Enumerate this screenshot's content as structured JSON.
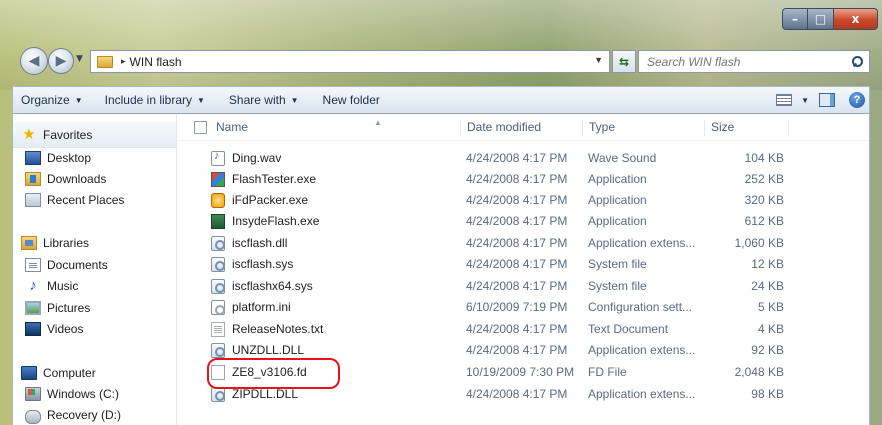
{
  "window": {
    "minimize_label": "–",
    "maximize_label": "□",
    "close_label": "x"
  },
  "address_bar": {
    "back_label": "◀",
    "forward_label": "▶",
    "separator": "▸",
    "path": "WIN flash",
    "dropdown_label": "▼",
    "refresh_label": "⇆",
    "search_placeholder": "Search WIN flash"
  },
  "toolbar": {
    "organize": "Organize",
    "include_in_library": "Include in library",
    "share_with": "Share with",
    "new_folder": "New folder",
    "arrow": "▼",
    "help": "?"
  },
  "nav_pane": {
    "favorites": "Favorites",
    "desktop": "Desktop",
    "downloads": "Downloads",
    "recent_places": "Recent Places",
    "libraries": "Libraries",
    "documents": "Documents",
    "music": "Music",
    "pictures": "Pictures",
    "videos": "Videos",
    "computer": "Computer",
    "windows_c": "Windows (C:)",
    "recovery_d": "Recovery (D:)",
    "star_glyph": "★",
    "music_glyph": "♪"
  },
  "columns": {
    "name": "Name",
    "date_modified": "Date modified",
    "type": "Type",
    "size": "Size",
    "sort_glyph": "▲"
  },
  "files": [
    {
      "name": "Ding.wav",
      "date": "4/24/2008 4:17 PM",
      "type": "Wave Sound",
      "size": "104 KB",
      "icon": "audio-file-icon"
    },
    {
      "name": "FlashTester.exe",
      "date": "4/24/2008 4:17 PM",
      "type": "Application",
      "size": "252 KB",
      "icon": "application-icon"
    },
    {
      "name": "iFdPacker.exe",
      "date": "4/24/2008 4:17 PM",
      "type": "Application",
      "size": "320 KB",
      "icon": "application-icon"
    },
    {
      "name": "InsydeFlash.exe",
      "date": "4/24/2008 4:17 PM",
      "type": "Application",
      "size": "612 KB",
      "icon": "application-icon"
    },
    {
      "name": "iscflash.dll",
      "date": "4/24/2008 4:17 PM",
      "type": "Application extens...",
      "size": "1,060 KB",
      "icon": "dll-file-icon"
    },
    {
      "name": "iscflash.sys",
      "date": "4/24/2008 4:17 PM",
      "type": "System file",
      "size": "12 KB",
      "icon": "system-file-icon"
    },
    {
      "name": "iscflashx64.sys",
      "date": "4/24/2008 4:17 PM",
      "type": "System file",
      "size": "24 KB",
      "icon": "system-file-icon"
    },
    {
      "name": "platform.ini",
      "date": "6/10/2009 7:19 PM",
      "type": "Configuration sett...",
      "size": "5 KB",
      "icon": "config-file-icon"
    },
    {
      "name": "ReleaseNotes.txt",
      "date": "4/24/2008 4:17 PM",
      "type": "Text Document",
      "size": "4 KB",
      "icon": "text-file-icon"
    },
    {
      "name": "UNZDLL.DLL",
      "date": "4/24/2008 4:17 PM",
      "type": "Application extens...",
      "size": "92 KB",
      "icon": "dll-file-icon"
    },
    {
      "name": "ZE8_v3106.fd",
      "date": "10/19/2009 7:30 PM",
      "type": "FD File",
      "size": "2,048 KB",
      "icon": "generic-file-icon"
    },
    {
      "name": "ZIPDLL.DLL",
      "date": "4/24/2008 4:17 PM",
      "type": "Application extens...",
      "size": "98 KB",
      "icon": "dll-file-icon"
    }
  ],
  "colors": {
    "highlight_ring": "#e5141b",
    "toolbar_text": "#1e3050",
    "secondary_text": "#5a6b80"
  }
}
